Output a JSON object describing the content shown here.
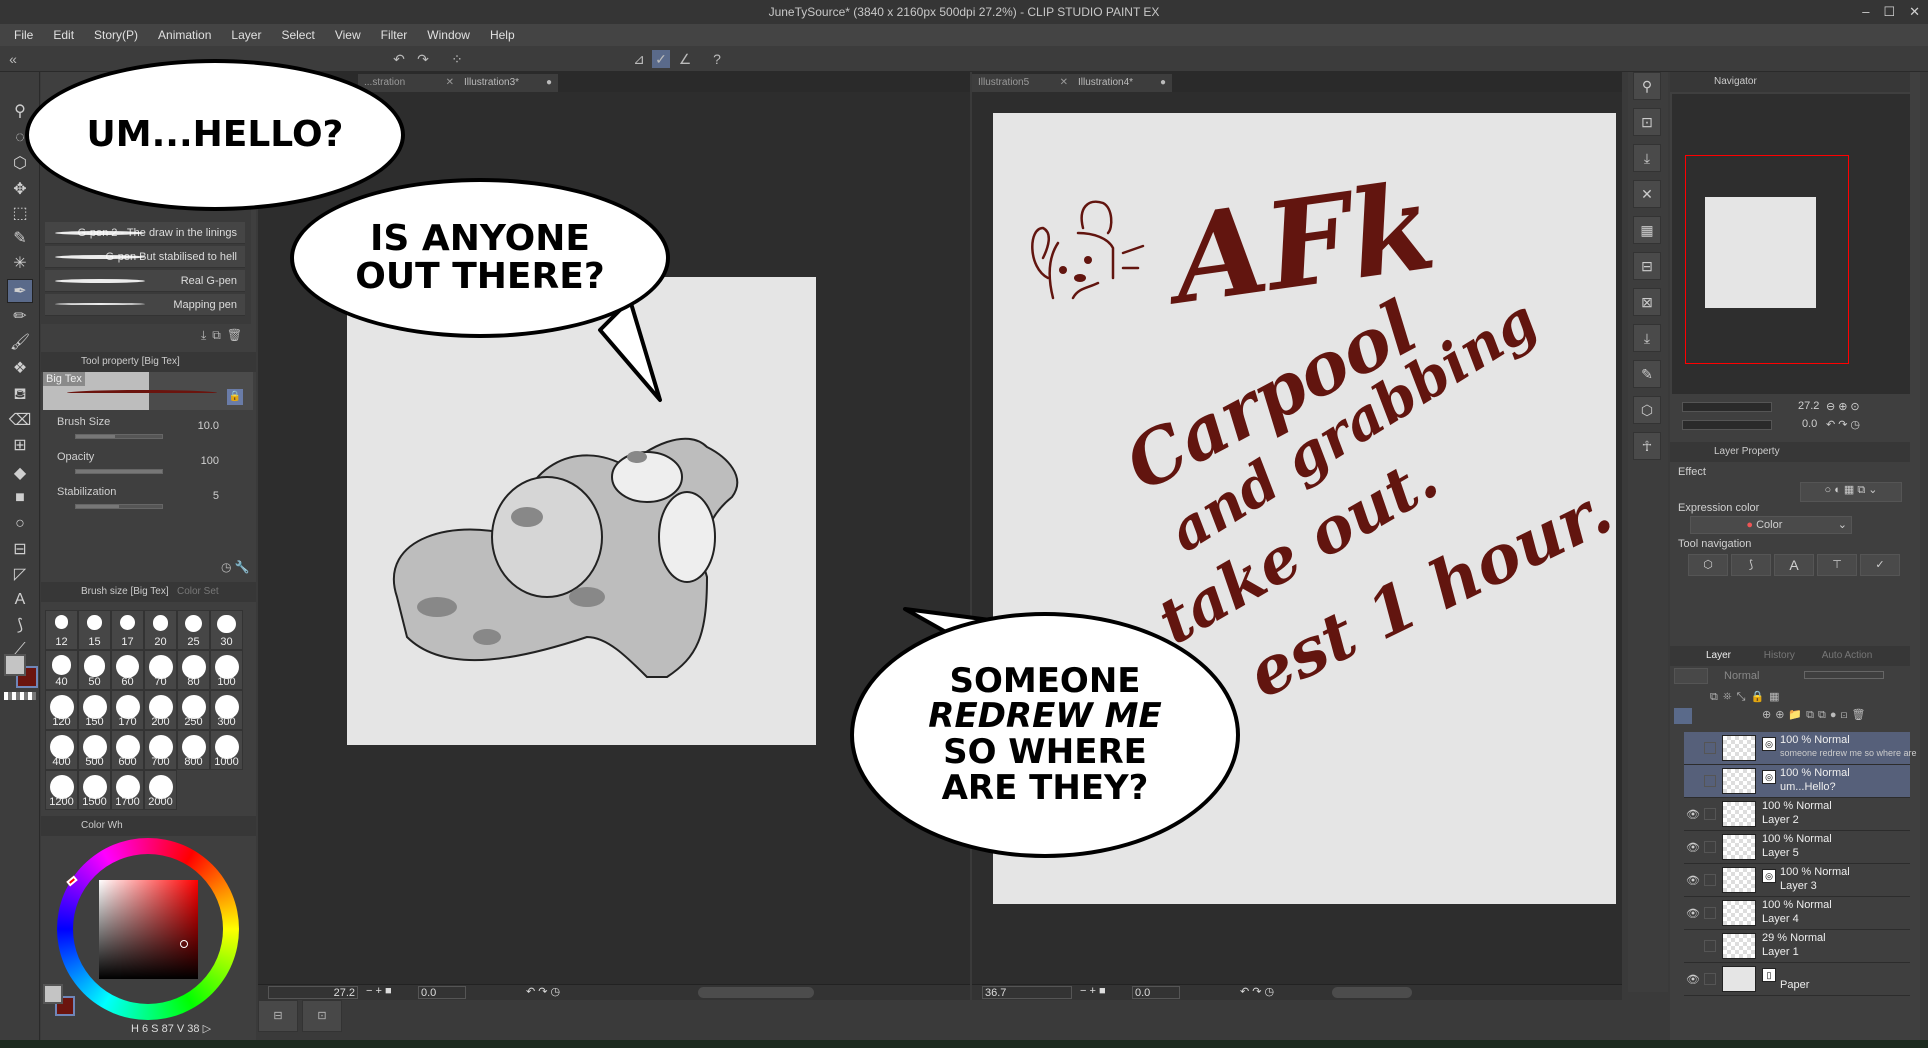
{
  "app": {
    "title": "JuneTySource* (3840 x 2160px 500dpi 27.2%)  - CLIP STUDIO PAINT EX",
    "window_controls": [
      "–",
      "☐",
      "✕"
    ]
  },
  "menu": [
    "File",
    "Edit",
    "Story(P)",
    "Animation",
    "Layer",
    "Select",
    "View",
    "Filter",
    "Window",
    "Help"
  ],
  "sub_tool": {
    "items": [
      "G-pen 2 - The draw in the linings",
      "G-pen But stabilised to hell",
      "Real G-pen",
      "Mapping pen"
    ]
  },
  "tool_property": {
    "header": "Tool property [Big Tex]",
    "preview_label": "Big Tex",
    "brush_size_label": "Brush Size",
    "brush_size": "10.0",
    "brush_size_fraction": 0.45,
    "opacity_label": "Opacity",
    "opacity": "100",
    "opacity_fraction": 1.0,
    "stabilization_label": "Stabilization",
    "stabilization": "5",
    "stabilization_fraction": 0.5
  },
  "brush_size_panel": {
    "header": "Brush size [Big Tex]",
    "tab2": "Color Set",
    "sizes": [
      "12",
      "15",
      "17",
      "20",
      "25",
      "30",
      "40",
      "50",
      "60",
      "70",
      "80",
      "100",
      "120",
      "150",
      "170",
      "200",
      "250",
      "300",
      "400",
      "500",
      "600",
      "700",
      "800",
      "1000",
      "1200",
      "1500",
      "1700",
      "2000"
    ]
  },
  "color_wheel": {
    "header": "Color Wh",
    "main_color": "#6b140e",
    "sub_color": "#c4c4c4",
    "h": "6",
    "s": "87",
    "v": "38"
  },
  "canvas_left": {
    "tabs": [
      "...stration",
      "Illustration3*"
    ],
    "zoom": "27.2",
    "rotation": "0.0"
  },
  "canvas_right": {
    "tabs": [
      "Illustration5",
      "Illustration4*"
    ],
    "zoom": "36.7",
    "rotation": "0.0"
  },
  "bubbles": {
    "b1": "UM...HELLO?",
    "b2": "IS ANYONE OUT THERE?",
    "b3_lines": [
      "SOMEONE",
      "REDREW ME",
      "SO WHERE",
      "ARE THEY?"
    ]
  },
  "handwriting": {
    "l1": "AFk",
    "l2": "Carpool",
    "l3": "and grabbing",
    "l4": "take out.",
    "l5": "est 1 hour.",
    "ink_color": "#62150f"
  },
  "navigator": {
    "title": "Navigator",
    "zoom": "27.2",
    "rotation": "0.0"
  },
  "layer_property": {
    "title": "Layer Property",
    "effect": "Effect",
    "expression_color_label": "Expression color",
    "expression_color": "Color",
    "tool_navigation": "Tool navigation"
  },
  "layer_panel": {
    "tabs": [
      "Layer",
      "History",
      "Auto Action"
    ],
    "blend_mode": "Normal",
    "layers": [
      {
        "mode": "100 % Normal",
        "name": "someone redrew me so where are",
        "visible": false,
        "selected": true
      },
      {
        "mode": "100 % Normal",
        "name": "um...Hello?",
        "visible": false,
        "selected": true
      },
      {
        "mode": "100 % Normal",
        "name": "Layer 2",
        "visible": true,
        "selected": false
      },
      {
        "mode": "100 % Normal",
        "name": "Layer 5",
        "visible": true,
        "selected": false
      },
      {
        "mode": "100 % Normal",
        "name": "Layer 3",
        "visible": true,
        "selected": false
      },
      {
        "mode": "100 % Normal",
        "name": "Layer 4",
        "visible": true,
        "selected": false
      },
      {
        "mode": "29 % Normal",
        "name": "Layer 1",
        "visible": false,
        "selected": false
      },
      {
        "mode": "",
        "name": "Paper",
        "visible": true,
        "selected": false
      }
    ]
  }
}
